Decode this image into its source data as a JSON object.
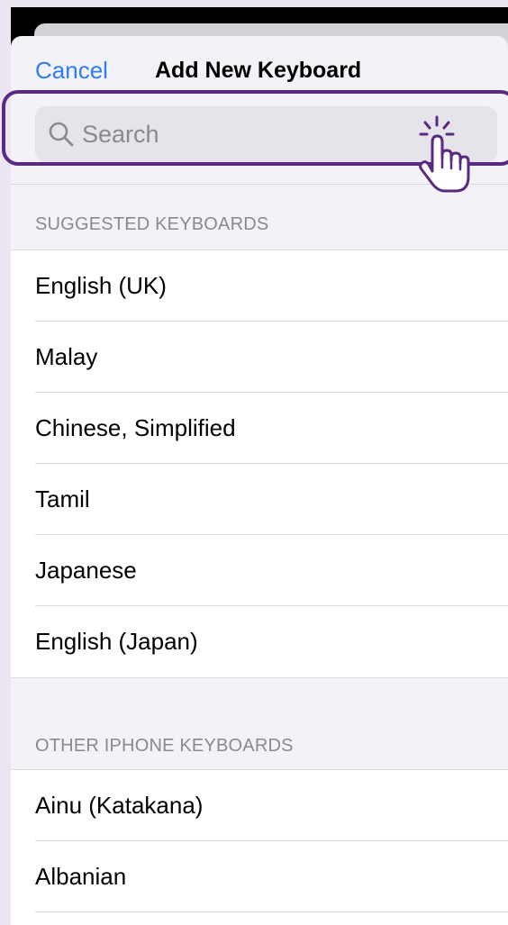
{
  "nav": {
    "cancel_label": "Cancel",
    "title": "Add New Keyboard"
  },
  "search": {
    "placeholder": "Search"
  },
  "suggested": {
    "header": "SUGGESTED KEYBOARDS",
    "items": [
      {
        "label": "English (UK)"
      },
      {
        "label": "Malay"
      },
      {
        "label": "Chinese, Simplified"
      },
      {
        "label": "Tamil"
      },
      {
        "label": "Japanese"
      },
      {
        "label": "English (Japan)"
      }
    ]
  },
  "other": {
    "header": "OTHER IPHONE KEYBOARDS",
    "items": [
      {
        "label": "Ainu (Katakana)"
      },
      {
        "label": "Albanian"
      }
    ]
  },
  "colors": {
    "accent": "#2F7CF6",
    "highlight": "#5A2A82",
    "background": "#ECE6F3"
  },
  "icons": {
    "search": "magnifying-glass",
    "pointer": "tap-hand"
  }
}
